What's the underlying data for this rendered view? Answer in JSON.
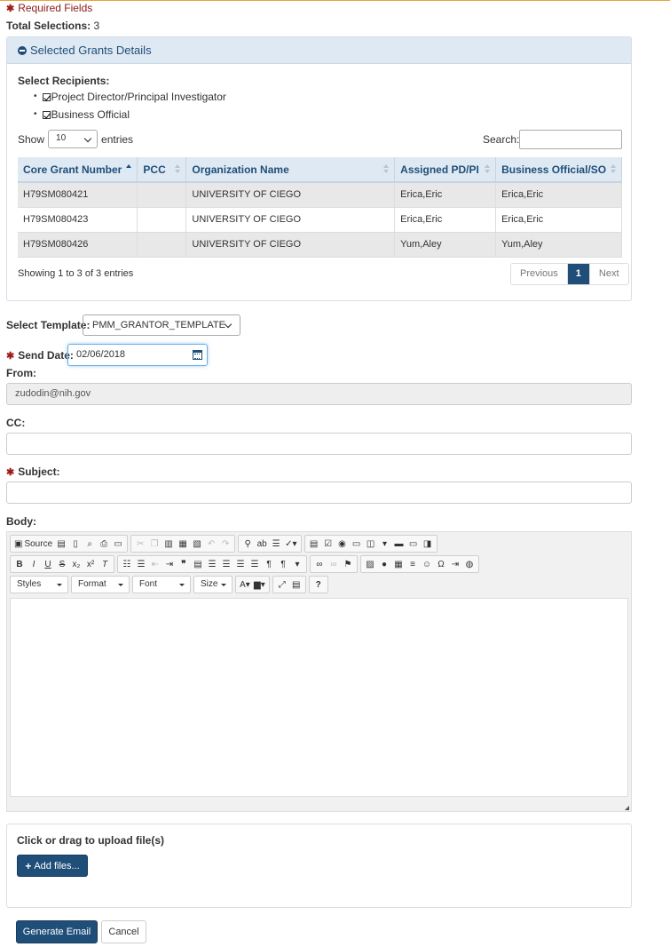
{
  "header": {
    "required_label": "Required Fields",
    "total_label": "Total Selections:",
    "total_value": "3"
  },
  "panel": {
    "title": "Selected Grants Details",
    "recipients_title": "Select Recipients:",
    "recipients": [
      {
        "label": "Project Director/Principal Investigator",
        "checked": true
      },
      {
        "label": "Business Official",
        "checked": true
      }
    ],
    "show_label": "Show",
    "page_length": "10",
    "entries_label": "entries",
    "search_label": "Search:",
    "search_value": "",
    "columns": [
      "Core Grant Number",
      "PCC",
      "Organization Name",
      "Assigned PD/PI",
      "Business Official/SO"
    ],
    "rows": [
      [
        "H79SM080421",
        "",
        "UNIVERSITY OF CIEGO",
        "Erica,Eric",
        "Erica,Eric"
      ],
      [
        "H79SM080423",
        "",
        "UNIVERSITY OF CIEGO",
        "Erica,Eric",
        "Erica,Eric"
      ],
      [
        "H79SM080426",
        "",
        "UNIVERSITY OF CIEGO",
        "Yum,Aley",
        "Yum,Aley"
      ]
    ],
    "info": "Showing 1 to 3 of 3 entries",
    "pager": {
      "previous": "Previous",
      "current": "1",
      "next": "Next"
    }
  },
  "form": {
    "template_label": "Select Template:",
    "template_value": "PMM_GRANTOR_TEMPLATE",
    "send_date_label": "Send Date:",
    "send_date_value": "02/06/2018",
    "from_label": "From:",
    "from_value": "zudodin@nih.gov",
    "cc_label": "CC:",
    "cc_value": "",
    "subject_label": "Subject:",
    "subject_value": "",
    "body_label": "Body:"
  },
  "editor": {
    "source_label": "Source",
    "styles_label": "Styles",
    "format_label": "Format",
    "font_label": "Font",
    "size_label": "Size"
  },
  "upload": {
    "label": "Click or drag to upload file(s)",
    "add_files": "Add files..."
  },
  "actions": {
    "generate": "Generate Email",
    "cancel": "Cancel"
  },
  "colors": {
    "primary": "#1f4e79",
    "panel_header": "#dfe9f3",
    "required": "#a01b1b",
    "top_rule": "#e8a33c"
  }
}
